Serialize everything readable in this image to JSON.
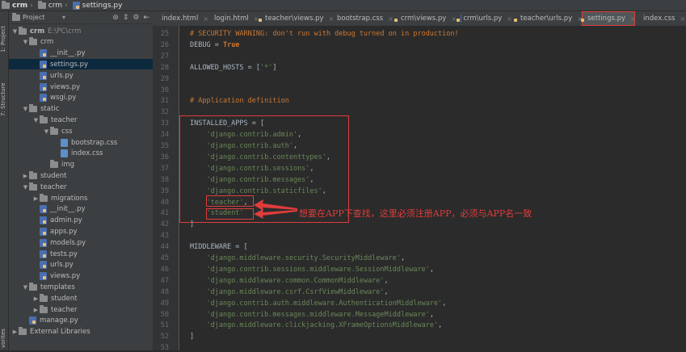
{
  "breadcrumb": [
    {
      "icon": "folder-icon",
      "label": "crm"
    },
    {
      "icon": "folder-icon",
      "label": "crm"
    },
    {
      "icon": "python-file-icon",
      "label": "settings.py"
    }
  ],
  "side_tabs": [
    "1: Project",
    "7: Structure",
    "vorites"
  ],
  "project_panel": {
    "selector_label": "Project",
    "tools": [
      "target-icon",
      "split-icon",
      "gear-icon",
      "hide-icon"
    ]
  },
  "tree": [
    {
      "label": "crm",
      "extra": "E:\\PC\\crm",
      "icon": "folder-icon",
      "expanded": true,
      "bold": true
    },
    {
      "label": "crm",
      "icon": "folder-icon",
      "expanded": true
    },
    {
      "label": "__init__.py",
      "icon": "python-file-icon"
    },
    {
      "label": "settings.py",
      "icon": "python-file-icon",
      "selected": true
    },
    {
      "label": "urls.py",
      "icon": "python-file-icon"
    },
    {
      "label": "views.py",
      "icon": "python-file-icon"
    },
    {
      "label": "wsgi.py",
      "icon": "python-file-icon"
    },
    {
      "label": "static",
      "icon": "folder-icon",
      "expanded": true
    },
    {
      "label": "teacher",
      "icon": "folder-icon",
      "expanded": true
    },
    {
      "label": "css",
      "icon": "folder-icon",
      "expanded": true
    },
    {
      "label": "bootstrap.css",
      "icon": "css-file-icon"
    },
    {
      "label": "index.css",
      "icon": "css-file-icon"
    },
    {
      "label": "img",
      "icon": "folder-icon"
    },
    {
      "label": "student",
      "icon": "folder-icon",
      "collapsed": true
    },
    {
      "label": "teacher",
      "icon": "folder-icon",
      "expanded": true
    },
    {
      "label": "migrations",
      "icon": "folder-icon",
      "collapsed": true
    },
    {
      "label": "__init__.py",
      "icon": "python-file-icon"
    },
    {
      "label": "admin.py",
      "icon": "python-file-icon"
    },
    {
      "label": "apps.py",
      "icon": "python-file-icon"
    },
    {
      "label": "models.py",
      "icon": "python-file-icon"
    },
    {
      "label": "tests.py",
      "icon": "python-file-icon"
    },
    {
      "label": "urls.py",
      "icon": "python-file-icon"
    },
    {
      "label": "views.py",
      "icon": "python-file-icon"
    },
    {
      "label": "templates",
      "icon": "folder-icon",
      "expanded": true
    },
    {
      "label": "student",
      "icon": "folder-icon",
      "collapsed": true
    },
    {
      "label": "teacher",
      "icon": "folder-icon",
      "collapsed": true
    },
    {
      "label": "manage.py",
      "icon": "python-file-icon"
    },
    {
      "label": "External Libraries",
      "icon": "library-icon",
      "collapsed": true
    }
  ],
  "tabs": [
    {
      "label": "index.html",
      "icon": "html-file-icon"
    },
    {
      "label": "login.html",
      "icon": "html-file-icon"
    },
    {
      "label": "teacher\\views.py",
      "icon": "python-file-icon"
    },
    {
      "label": "bootstrap.css",
      "icon": "css-file-icon"
    },
    {
      "label": "crm\\views.py",
      "icon": "python-file-icon"
    },
    {
      "label": "crm\\urls.py",
      "icon": "python-file-icon"
    },
    {
      "label": "teacher\\urls.py",
      "icon": "python-file-icon"
    },
    {
      "label": "settings.py",
      "icon": "python-file-icon",
      "active": true
    },
    {
      "label": "index.css",
      "icon": "css-file-icon"
    }
  ],
  "code_lines": [
    {
      "n": "25",
      "parts": [
        {
          "t": "# SECURITY WARNING: don't run with debug turned on in production!",
          "c": "cmt"
        }
      ]
    },
    {
      "n": "26",
      "parts": [
        {
          "t": "DEBUG = ",
          "c": ""
        },
        {
          "t": "True",
          "c": "const"
        }
      ]
    },
    {
      "n": "27",
      "parts": []
    },
    {
      "n": "28",
      "parts": [
        {
          "t": "ALLOWED_HOSTS = [",
          "c": ""
        },
        {
          "t": "'*'",
          "c": "str"
        },
        {
          "t": "]",
          "c": ""
        }
      ]
    },
    {
      "n": "29",
      "parts": []
    },
    {
      "n": "30",
      "parts": []
    },
    {
      "n": "31",
      "parts": [
        {
          "t": "# Application definition",
          "c": "cmt"
        }
      ]
    },
    {
      "n": "32",
      "parts": []
    },
    {
      "n": "33",
      "parts": [
        {
          "t": "INSTALLED_APPS = [",
          "c": ""
        }
      ]
    },
    {
      "n": "34",
      "parts": [
        {
          "t": "    ",
          "c": ""
        },
        {
          "t": "'django.contrib.admin'",
          "c": "str"
        },
        {
          "t": ",",
          "c": ""
        }
      ]
    },
    {
      "n": "35",
      "parts": [
        {
          "t": "    ",
          "c": ""
        },
        {
          "t": "'django.contrib.auth'",
          "c": "str"
        },
        {
          "t": ",",
          "c": ""
        }
      ]
    },
    {
      "n": "36",
      "parts": [
        {
          "t": "    ",
          "c": ""
        },
        {
          "t": "'django.contrib.contenttypes'",
          "c": "str"
        },
        {
          "t": ",",
          "c": ""
        }
      ]
    },
    {
      "n": "37",
      "parts": [
        {
          "t": "    ",
          "c": ""
        },
        {
          "t": "'django.contrib.sessions'",
          "c": "str"
        },
        {
          "t": ",",
          "c": ""
        }
      ]
    },
    {
      "n": "38",
      "parts": [
        {
          "t": "    ",
          "c": ""
        },
        {
          "t": "'django.contrib.messages'",
          "c": "str"
        },
        {
          "t": ",",
          "c": ""
        }
      ]
    },
    {
      "n": "39",
      "parts": [
        {
          "t": "    ",
          "c": ""
        },
        {
          "t": "'django.contrib.staticfiles'",
          "c": "str"
        },
        {
          "t": ",",
          "c": ""
        }
      ]
    },
    {
      "n": "40",
      "parts": [
        {
          "t": "    ",
          "c": ""
        },
        {
          "t": "'teacher'",
          "c": "str"
        },
        {
          "t": ",",
          "c": ""
        }
      ]
    },
    {
      "n": "41",
      "parts": [
        {
          "t": "    ",
          "c": ""
        },
        {
          "t": "'student'",
          "c": "str"
        }
      ]
    },
    {
      "n": "42",
      "parts": [
        {
          "t": "]",
          "c": ""
        }
      ]
    },
    {
      "n": "43",
      "parts": []
    },
    {
      "n": "44",
      "parts": [
        {
          "t": "MIDDLEWARE = [",
          "c": ""
        }
      ]
    },
    {
      "n": "45",
      "parts": [
        {
          "t": "    ",
          "c": ""
        },
        {
          "t": "'django.middleware.security.SecurityMiddleware'",
          "c": "str"
        },
        {
          "t": ",",
          "c": ""
        }
      ]
    },
    {
      "n": "46",
      "parts": [
        {
          "t": "    ",
          "c": ""
        },
        {
          "t": "'django.contrib.sessions.middleware.SessionMiddleware'",
          "c": "str"
        },
        {
          "t": ",",
          "c": ""
        }
      ]
    },
    {
      "n": "47",
      "parts": [
        {
          "t": "    ",
          "c": ""
        },
        {
          "t": "'django.middleware.common.CommonMiddleware'",
          "c": "str"
        },
        {
          "t": ",",
          "c": ""
        }
      ]
    },
    {
      "n": "48",
      "parts": [
        {
          "t": "    ",
          "c": ""
        },
        {
          "t": "'django.middleware.csrf.CsrfViewMiddleware'",
          "c": "str"
        },
        {
          "t": ",",
          "c": ""
        }
      ]
    },
    {
      "n": "49",
      "parts": [
        {
          "t": "    ",
          "c": ""
        },
        {
          "t": "'django.contrib.auth.middleware.AuthenticationMiddleware'",
          "c": "str"
        },
        {
          "t": ",",
          "c": ""
        }
      ]
    },
    {
      "n": "50",
      "parts": [
        {
          "t": "    ",
          "c": ""
        },
        {
          "t": "'django.contrib.messages.middleware.MessageMiddleware'",
          "c": "str"
        },
        {
          "t": ",",
          "c": ""
        }
      ]
    },
    {
      "n": "51",
      "parts": [
        {
          "t": "    ",
          "c": ""
        },
        {
          "t": "'django.middleware.clickjacking.XFrameOptionsMiddleware'",
          "c": "str"
        },
        {
          "t": ",",
          "c": ""
        }
      ]
    },
    {
      "n": "52",
      "parts": [
        {
          "t": "]",
          "c": ""
        }
      ]
    },
    {
      "n": "53",
      "parts": []
    }
  ],
  "annotation": {
    "text": "想要在APP下查找，这里必须注册APP，必须与APP名一致",
    "color": "#e03c3c"
  },
  "colors": {
    "background": "#2b2b2b",
    "panel": "#3c3f41",
    "selection": "#0d293e",
    "comment": "#cc7832",
    "string": "#6a8759",
    "highlight_box": "#e03c3c"
  }
}
